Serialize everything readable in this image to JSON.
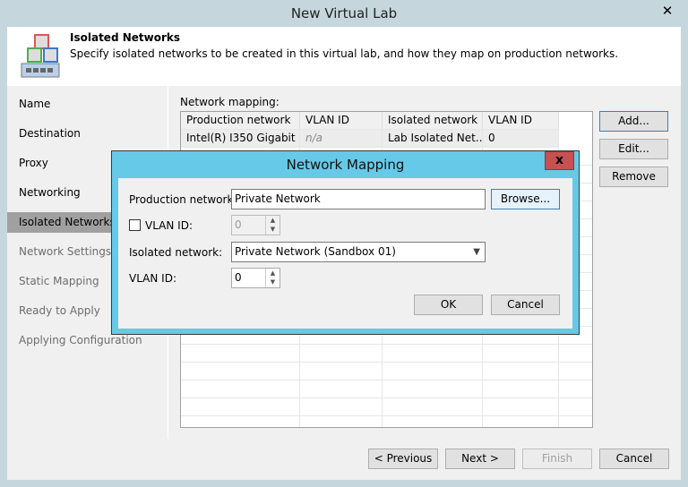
{
  "window": {
    "title": "New Virtual Lab",
    "close": "✕"
  },
  "header": {
    "title": "Isolated Networks",
    "description": "Specify isolated networks to be created in this virtual lab, and how they map on production networks."
  },
  "sidebar": {
    "items": [
      {
        "label": "Name",
        "state": "done"
      },
      {
        "label": "Destination",
        "state": "done"
      },
      {
        "label": "Proxy",
        "state": "done"
      },
      {
        "label": "Networking",
        "state": "done"
      },
      {
        "label": "Isolated Networks",
        "state": "selected"
      },
      {
        "label": "Network Settings",
        "state": "pending"
      },
      {
        "label": "Static Mapping",
        "state": "pending"
      },
      {
        "label": "Ready to Apply",
        "state": "pending"
      },
      {
        "label": "Applying Configuration",
        "state": "pending"
      }
    ]
  },
  "mapping": {
    "label": "Network mapping:",
    "columns": [
      "Production network",
      "VLAN ID",
      "Isolated network",
      "VLAN ID"
    ],
    "rows": [
      [
        "Intel(R) I350 Gigabit ...",
        "n/a",
        "Lab Isolated Net...",
        "0"
      ]
    ]
  },
  "side_buttons": {
    "add": "Add...",
    "edit": "Edit...",
    "remove": "Remove"
  },
  "footer": {
    "previous": "< Previous",
    "next": "Next >",
    "finish": "Finish",
    "cancel": "Cancel"
  },
  "dialog": {
    "title": "Network Mapping",
    "close": "x",
    "production_label": "Production network:",
    "production_value": "Private Network",
    "browse": "Browse...",
    "vlan_check_label": "VLAN ID:",
    "vlan_checked": false,
    "vlan_value_disabled": "0",
    "isolated_label": "Isolated network:",
    "isolated_value": "Private Network (Sandbox 01)",
    "vlan_label": "VLAN ID:",
    "vlan_value": "0",
    "ok": "OK",
    "cancel": "Cancel"
  }
}
